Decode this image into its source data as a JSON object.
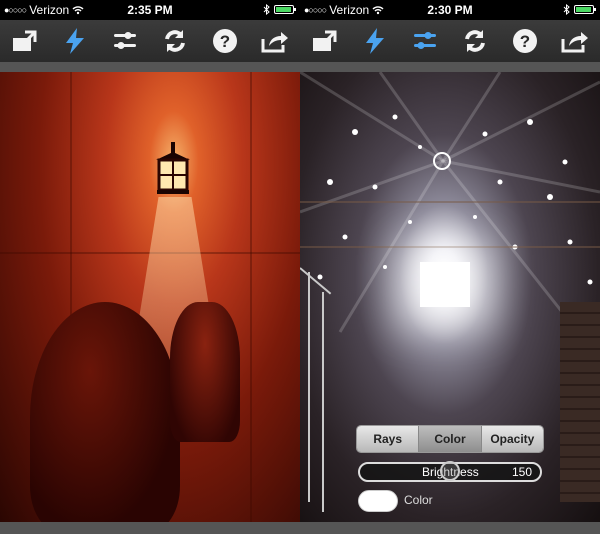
{
  "screens": [
    {
      "status": {
        "carrier": "Verizon",
        "time": "2:35 PM"
      },
      "toolbar": [
        "open-photo-icon",
        "lightning-icon",
        "adjust-sliders-icon",
        "refresh-icon",
        "help-icon",
        "share-icon"
      ]
    },
    {
      "status": {
        "carrier": "Verizon",
        "time": "2:30 PM"
      },
      "toolbar": [
        "open-photo-icon",
        "lightning-icon",
        "adjust-sliders-icon",
        "refresh-icon",
        "help-icon",
        "share-icon"
      ],
      "panel": {
        "tabs": [
          "Rays",
          "Color",
          "Opacity"
        ],
        "active_tab": "Color",
        "slider": {
          "label": "Brightness",
          "value": "150",
          "level": 0.5
        },
        "color_label": "Color",
        "swatch_color": "#ffffff"
      }
    }
  ],
  "colors": {
    "toolbar_icon": "#f2f2f2",
    "accent_blue": "#4aa3f0",
    "battery_green": "#4cd964"
  }
}
